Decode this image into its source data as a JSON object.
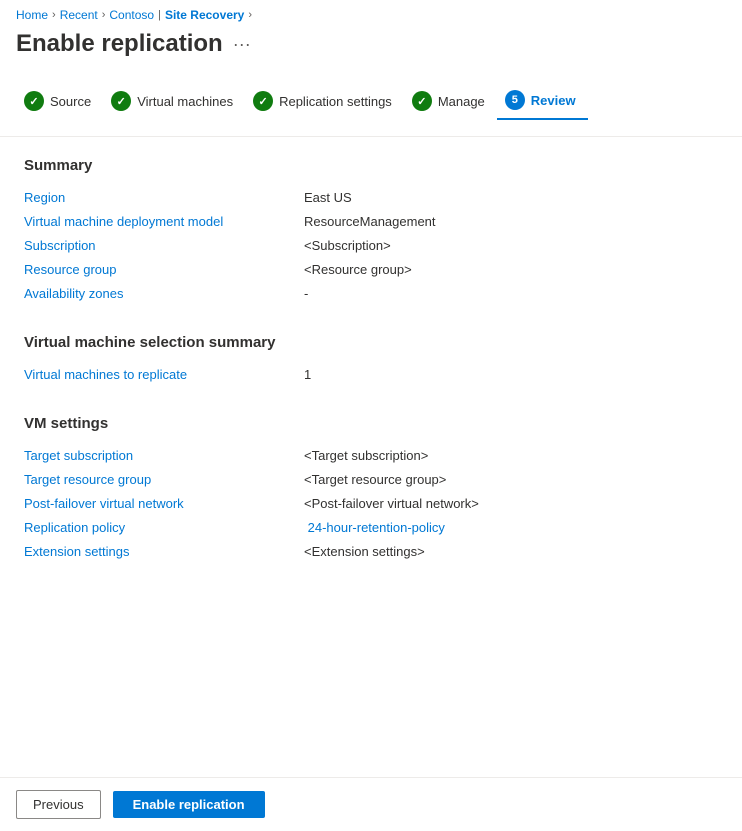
{
  "breadcrumb": {
    "home": "Home",
    "recent": "Recent",
    "contoso": "Contoso",
    "site_recovery": "Site Recovery",
    "sep": "›"
  },
  "page": {
    "title": "Enable replication",
    "dots": "···"
  },
  "steps": [
    {
      "id": "source",
      "label": "Source",
      "status": "complete"
    },
    {
      "id": "virtual-machines",
      "label": "Virtual machines",
      "status": "complete"
    },
    {
      "id": "replication-settings",
      "label": "Replication settings",
      "status": "complete"
    },
    {
      "id": "manage",
      "label": "Manage",
      "status": "complete"
    },
    {
      "id": "review",
      "label": "Review",
      "status": "active",
      "number": "5"
    }
  ],
  "summary_section": {
    "title": "Summary",
    "rows": [
      {
        "label": "Region",
        "value": "East US",
        "type": "text"
      },
      {
        "label": "Virtual machine deployment model",
        "value": "ResourceManagement",
        "type": "text"
      },
      {
        "label": "Subscription",
        "value": "<Subscription>",
        "type": "text"
      },
      {
        "label": "Resource group",
        "value": "<Resource group>",
        "type": "text"
      },
      {
        "label": "Availability zones",
        "value": "-",
        "type": "text"
      }
    ]
  },
  "vm_selection_section": {
    "title": "Virtual machine selection summary",
    "rows": [
      {
        "label": "Virtual machines to replicate",
        "value": "1",
        "type": "text"
      }
    ]
  },
  "vm_settings_section": {
    "title": "VM settings",
    "rows": [
      {
        "label": "Target subscription",
        "value": "<Target subscription>",
        "type": "text"
      },
      {
        "label": "Target resource group",
        "value": "<Target resource group>",
        "type": "text"
      },
      {
        "label": "Post-failover virtual network",
        "value": "<Post-failover virtual network>",
        "type": "text"
      },
      {
        "label": "Replication policy",
        "value": "24-hour-retention-policy",
        "type": "link"
      },
      {
        "label": "Extension settings",
        "value": "<Extension settings>",
        "type": "text"
      }
    ]
  },
  "footer": {
    "previous": "Previous",
    "enable": "Enable replication"
  }
}
